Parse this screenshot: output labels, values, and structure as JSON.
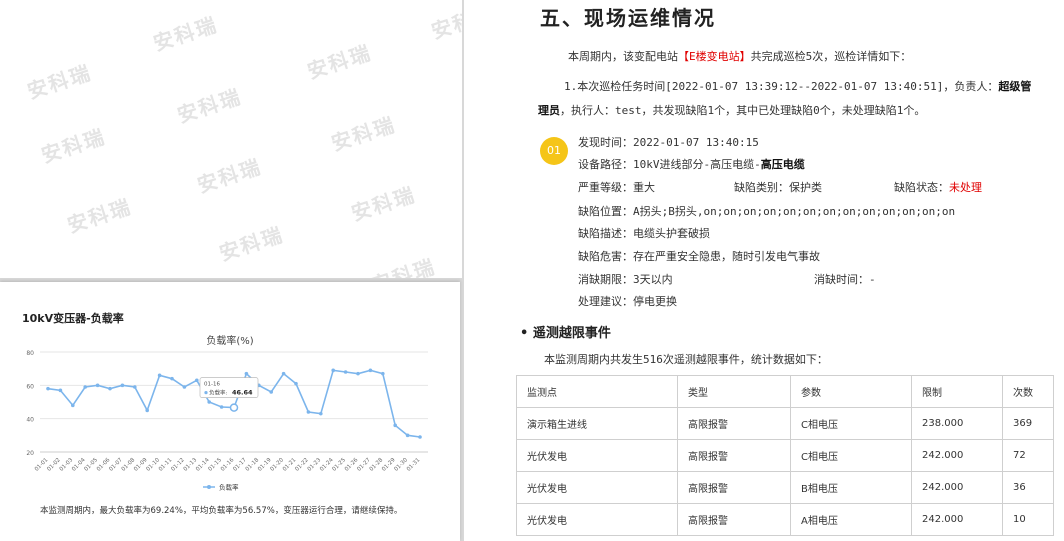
{
  "watermark_text": "安科瑞",
  "chart_section_title": "10kV变压器-负载率",
  "chart_data": {
    "type": "line",
    "title": "负载率(%)",
    "categories": [
      "01-01",
      "01-02",
      "01-03",
      "01-04",
      "01-05",
      "01-06",
      "01-07",
      "01-08",
      "01-09",
      "01-10",
      "01-11",
      "01-12",
      "01-13",
      "01-14",
      "01-15",
      "01-16",
      "01-17",
      "01-18",
      "01-19",
      "01-20",
      "01-21",
      "01-22",
      "01-23",
      "01-24",
      "01-25",
      "01-26",
      "01-27",
      "01-28",
      "01-29",
      "01-30",
      "01-31"
    ],
    "series": [
      {
        "name": "负载率",
        "values": [
          58,
          57,
          48,
          59,
          60,
          58,
          60,
          59,
          45,
          66,
          64,
          59,
          63,
          50,
          47,
          46.64,
          67,
          60,
          56,
          67,
          61,
          44,
          43,
          69,
          68,
          67,
          69,
          67,
          36,
          30,
          29
        ]
      }
    ],
    "y_ticks": [
      20,
      40,
      60,
      80
    ],
    "ylim": [
      20,
      80
    ],
    "legend": "bottom",
    "tooltip": {
      "date": "01-16",
      "label": "负载率",
      "value": "46.64"
    },
    "colors": {
      "line": "#7cb5ec"
    }
  },
  "chart_summary": "本监测周期内，最大负载率为69.24%，平均负载率为56.57%，变压器运行合理，请继续保持。",
  "right": {
    "section_title": "五、现场运维情况",
    "intro_prefix": "本周期内，该变配电站",
    "intro_station": "【E楼变电站】",
    "intro_suffix": "共完成巡检5次，巡检详情如下：",
    "task_line1_prefix": "1.本次巡检任务时间[2022-01-07 13:39:12--2022-01-07 13:40:51]，负责人：",
    "task_line1_bold": "超级管",
    "task_line2_bold": "理员",
    "task_line2_rest": "，执行人：test，共发现缺陷1个，其中已处理缺陷0个，未处理缺陷1个。",
    "defect": {
      "badge": "01",
      "found_time": "发现时间：2022-01-07 13:40:15",
      "path_prefix": "设备路径：10kV进线部分-高压电缆-",
      "path_bold": "高压电缆",
      "severity": "严重等级：重大",
      "category": "缺陷类别：保护类",
      "status_label": "缺陷状态：",
      "status_value": "未处理",
      "location": "缺陷位置：A拐头;B拐头,on;on;on;on;on;on;on;on;on;on;on;on;on",
      "description": "缺陷描述：电缆头护套破损",
      "hazard": "缺陷危害：存在严重安全隐患，随时引发电气事故",
      "deadline": "消缺期限：3天以内",
      "fix_time": "消缺时间：-",
      "suggestion": "处理建议：停电更换"
    },
    "telemetry_title": "• 遥测越限事件",
    "telemetry_intro": "本监测周期内共发生516次遥测越限事件，统计数据如下：",
    "table": {
      "headers": [
        "监测点",
        "类型",
        "参数",
        "限制",
        "次数"
      ],
      "rows": [
        [
          "演示箱生进线",
          "高限报警",
          "C相电压",
          "238.000",
          "369"
        ],
        [
          "光伏发电",
          "高限报警",
          "C相电压",
          "242.000",
          "72"
        ],
        [
          "光伏发电",
          "高限报警",
          "B相电压",
          "242.000",
          "36"
        ],
        [
          "光伏发电",
          "高限报警",
          "A相电压",
          "242.000",
          "10"
        ]
      ]
    }
  }
}
